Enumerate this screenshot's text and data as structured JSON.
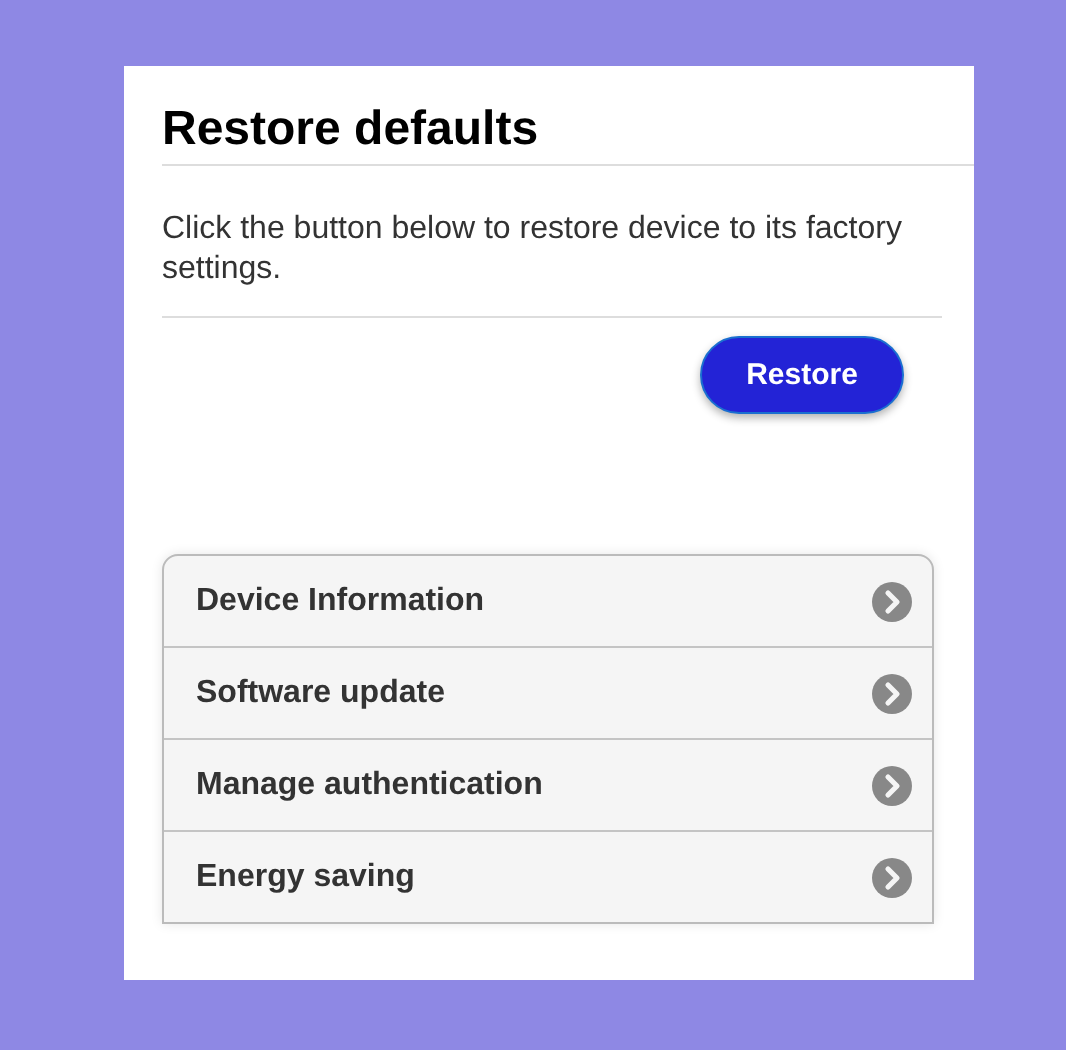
{
  "title": "Restore defaults",
  "description": "Click the button below to restore device to its factory settings.",
  "restore_button": "Restore",
  "menu": [
    {
      "label": "Device Information"
    },
    {
      "label": "Software update"
    },
    {
      "label": "Manage authentication"
    },
    {
      "label": "Energy saving"
    }
  ]
}
